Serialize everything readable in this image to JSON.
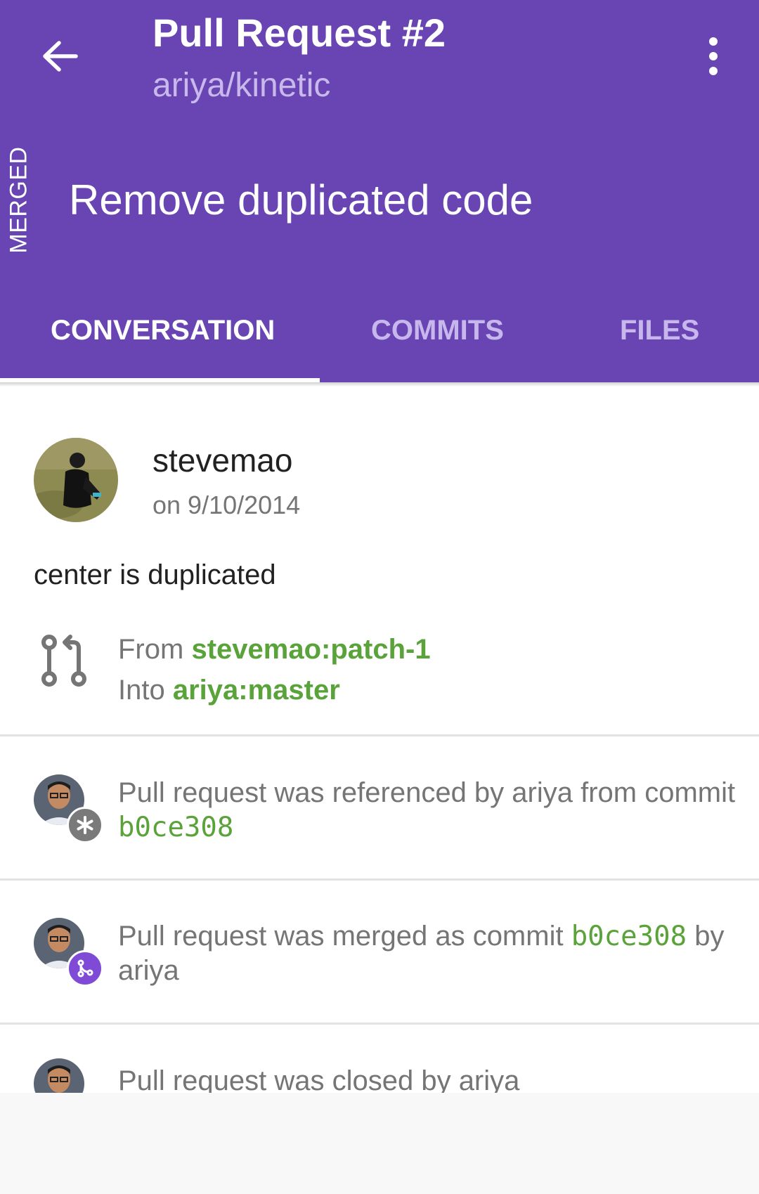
{
  "header": {
    "title": "Pull Request #2",
    "subtitle": "ariya/kinetic",
    "state": "MERGED",
    "pr_title": "Remove duplicated code",
    "background": "#6845b3"
  },
  "tabs": [
    {
      "label": "CONVERSATION",
      "active": true
    },
    {
      "label": "COMMITS",
      "active": false
    },
    {
      "label": "FILES",
      "active": false
    }
  ],
  "description": {
    "author": "stevemao",
    "date": "on 9/10/2014",
    "body": "center is duplicated",
    "from_label": "From",
    "from_branch": "stevemao:patch-1",
    "into_label": "Into",
    "into_branch": "ariya:master"
  },
  "events": [
    {
      "text_before": "Pull request was referenced by ariya from commit",
      "sha": "b0ce308",
      "text_after": "",
      "badge_icon": "asterisk-icon",
      "badge_color": "#7a7a7a"
    },
    {
      "text_before": "Pull request was merged as commit",
      "sha": "b0ce308",
      "text_after": "by ariya",
      "badge_icon": "merge-icon",
      "badge_color": "#7f4ad6"
    },
    {
      "text_before": "Pull request was closed by ariya",
      "sha": "",
      "text_after": ""
    }
  ],
  "colors": {
    "accent_green": "#5aa23a",
    "secondary_text": "#757575"
  }
}
